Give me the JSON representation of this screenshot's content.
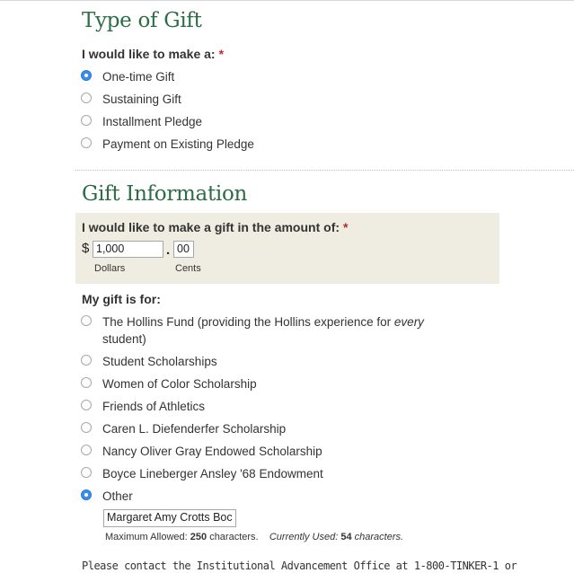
{
  "gift_type": {
    "title": "Type of Gift",
    "question": "I would like to make a:",
    "required_mark": "*",
    "options": [
      {
        "label": "One-time Gift",
        "checked": true
      },
      {
        "label": "Sustaining Gift",
        "checked": false
      },
      {
        "label": "Installment Pledge",
        "checked": false
      },
      {
        "label": "Payment on Existing Pledge",
        "checked": false
      }
    ]
  },
  "gift_info": {
    "title": "Gift Information",
    "amount_question": "I would like to make a gift in the amount of:",
    "required_mark": "*",
    "currency_symbol": "$",
    "dollars_value": "1,000",
    "decimal_point": ".",
    "cents_value": "00",
    "dollars_label": "Dollars",
    "cents_label": "Cents",
    "purpose_question": "My gift is for:",
    "purpose_options": [
      {
        "label_prefix": "The Hollins Fund (providing the Hollins experience for ",
        "label_emphasis": "every",
        "label_suffix": " student)",
        "checked": false
      },
      {
        "label": "Student Scholarships",
        "checked": false
      },
      {
        "label": "Women of Color Scholarship",
        "checked": false
      },
      {
        "label": "Friends of Athletics",
        "checked": false
      },
      {
        "label": "Caren L. Diefenderfer Scholarship",
        "checked": false
      },
      {
        "label": "Nancy Oliver Gray Endowed Scholarship",
        "checked": false
      },
      {
        "label": "Boyce Lineberger Ansley '68 Endowment",
        "checked": false
      },
      {
        "label": "Other",
        "checked": true
      }
    ],
    "other_value": "Margaret Amy Crotts Boc",
    "max_allowed_label": "Maximum Allowed:",
    "max_allowed_value": "250",
    "characters_word": "characters.",
    "currently_used_label": "Currently Used:",
    "currently_used_value": "54",
    "currently_used_suffix": "characters."
  },
  "footer": {
    "text": "Please contact the Institutional Advancement Office at 1-800-TINKER-1 or"
  },
  "colors": {
    "heading": "#2e6b47",
    "required": "#c0282d",
    "panel_background": "#efede2",
    "radio_checked": "#3b8ee8"
  }
}
